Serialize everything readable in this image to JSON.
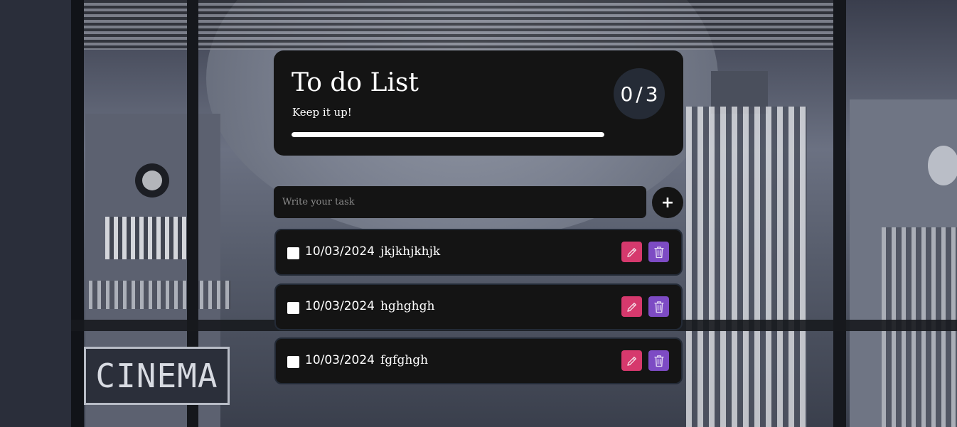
{
  "header": {
    "title": "To do List",
    "subtitle": "Keep it up!",
    "completed": "0",
    "separator": "/",
    "total": "3",
    "progress_fraction": 1.0
  },
  "input": {
    "placeholder": "Write your task",
    "value": ""
  },
  "add_button": {
    "label": "+"
  },
  "tasks": [
    {
      "date": "10/03/2024",
      "text": "jkjkhjkhjk",
      "done": false
    },
    {
      "date": "10/03/2024",
      "text": "hghghgh",
      "done": false
    },
    {
      "date": "10/03/2024",
      "text": "fgfghgh",
      "done": false
    }
  ],
  "background": {
    "sign_text": "CINEMA"
  },
  "icons": {
    "edit": "pencil-icon",
    "delete": "trash-icon",
    "add": "plus-icon"
  },
  "colors": {
    "card": "#141414",
    "edit": "#d6396d",
    "delete": "#7d4bc4",
    "badge": "#252b36"
  }
}
